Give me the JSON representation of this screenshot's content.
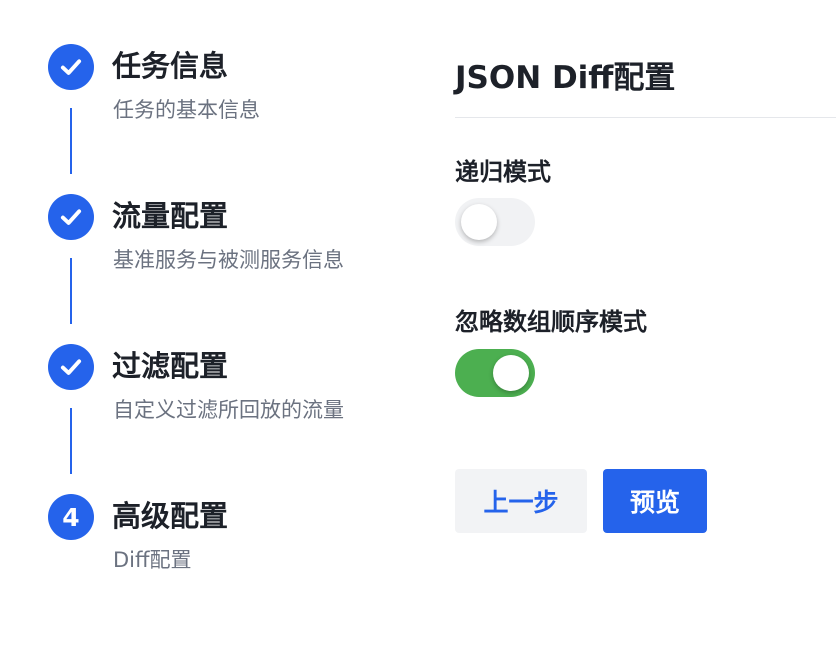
{
  "steps": [
    {
      "title": "任务信息",
      "description": "任务的基本信息",
      "status": "done",
      "icon": "check-icon"
    },
    {
      "title": "流量配置",
      "description": "基准服务与被测服务信息",
      "status": "done",
      "icon": "check-icon"
    },
    {
      "title": "过滤配置",
      "description": "自定义过滤所回放的流量",
      "status": "done",
      "icon": "check-icon"
    },
    {
      "title": "高级配置",
      "description": "Diff配置",
      "status": "current",
      "number": "4"
    }
  ],
  "panel": {
    "title": "JSON Diff配置",
    "fields": [
      {
        "label": "递归模式",
        "checked": false
      },
      {
        "label": "忽略数组顺序模式",
        "checked": true
      }
    ],
    "buttons": {
      "prev_label": "上一步",
      "preview_label": "预览"
    }
  },
  "colors": {
    "primary": "#2563eb",
    "switch_on": "#4caf50",
    "switch_off": "#f1f2f4",
    "text": "#1d2129",
    "muted": "#6b7280"
  }
}
